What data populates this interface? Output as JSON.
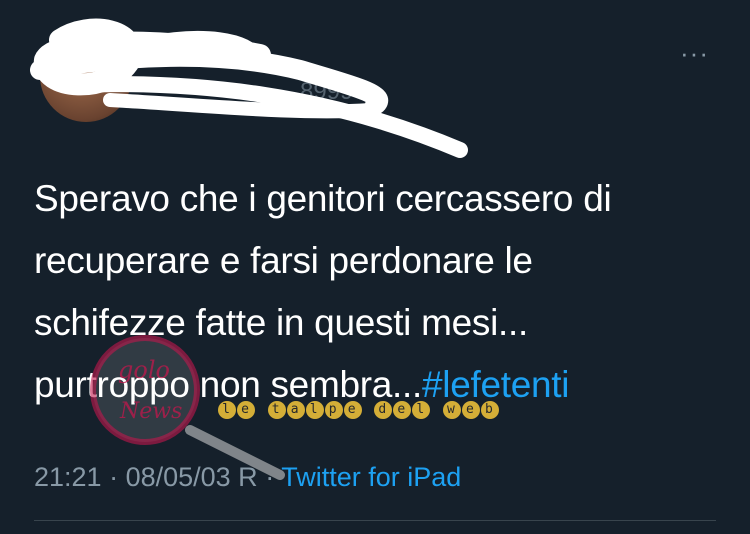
{
  "header": {
    "handle_fragment": "8999",
    "more_label": "···"
  },
  "tweet": {
    "lines": [
      "Speravo che i genitori cercassero di",
      "recuperare e farsi perdonare le",
      "schifezze fatte in questi mesi...",
      "purtroppo non sembra..."
    ],
    "hashtag": "#lefetenti"
  },
  "meta": {
    "time": "21:21",
    "separator": " · ",
    "date": "08/05/03 R",
    "separator2": " · ",
    "source": "Twitter for iPad"
  },
  "watermark": {
    "logo_text": "gololnews",
    "caption": "le talpe del web"
  },
  "colors": {
    "background": "#15202b",
    "text": "#ffffff",
    "secondary": "#8899a6",
    "link": "#1da1f2",
    "divider": "#38444d"
  },
  "icons": [
    "avatar",
    "more-icon"
  ]
}
